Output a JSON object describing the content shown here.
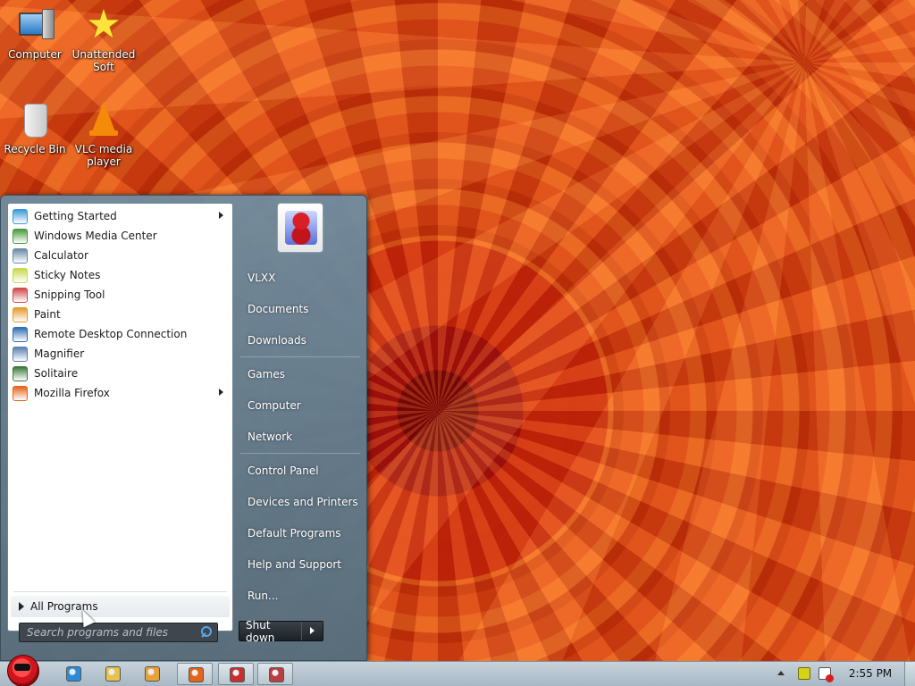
{
  "desktop": {
    "icons": [
      {
        "label": "Computer",
        "icon": "computer-icon"
      },
      {
        "label": "Unattended\nSoft",
        "icon": "star-icon"
      },
      {
        "label": "Recycle Bin",
        "icon": "recycle-bin-icon"
      },
      {
        "label": "VLC media\nplayer",
        "icon": "vlc-cone-icon"
      }
    ]
  },
  "start_menu": {
    "pinned": [
      {
        "label": "Getting Started",
        "icon": "getting-started-icon",
        "color": "#3b9ad9",
        "submenu": true
      },
      {
        "label": "Windows Media Center",
        "icon": "media-center-icon",
        "color": "#4a9a3c",
        "submenu": false
      },
      {
        "label": "Calculator",
        "icon": "calculator-icon",
        "color": "#6a8aa8",
        "submenu": false
      },
      {
        "label": "Sticky Notes",
        "icon": "sticky-notes-icon",
        "color": "#c9d84a",
        "submenu": false
      },
      {
        "label": "Snipping Tool",
        "icon": "snipping-tool-icon",
        "color": "#d24a4a",
        "submenu": false
      },
      {
        "label": "Paint",
        "icon": "paint-icon",
        "color": "#e59a2b",
        "submenu": false
      },
      {
        "label": "Remote Desktop Connection",
        "icon": "remote-desktop-icon",
        "color": "#2f6db5",
        "submenu": false
      },
      {
        "label": "Magnifier",
        "icon": "magnifier-icon",
        "color": "#5a7fb0",
        "submenu": false
      },
      {
        "label": "Solitaire",
        "icon": "solitaire-icon",
        "color": "#3a7a3a",
        "submenu": false
      },
      {
        "label": "Mozilla Firefox",
        "icon": "firefox-icon",
        "color": "#e5641a",
        "submenu": true
      }
    ],
    "all_programs": "All Programs",
    "search_placeholder": "Search programs and files",
    "right_links": {
      "user": "VLXX",
      "documents": "Documents",
      "downloads": "Downloads",
      "games": "Games",
      "computer": "Computer",
      "network": "Network",
      "control_panel": "Control Panel",
      "devices": "Devices and Printers",
      "default_programs": "Default Programs",
      "help": "Help and Support",
      "run": "Run..."
    },
    "shutdown_label": "Shut down"
  },
  "taskbar": {
    "pinned_apps": [
      {
        "icon": "internet-explorer-icon",
        "color": "#2c8ad8",
        "active": false
      },
      {
        "icon": "folder-icon",
        "color": "#e8c24a",
        "active": false
      },
      {
        "icon": "media-player-icon",
        "color": "#e8a23a",
        "active": false
      },
      {
        "icon": "firefox-icon",
        "color": "#e5641a",
        "active": true
      },
      {
        "icon": "app-red-icon",
        "color": "#c83030",
        "active": true
      },
      {
        "icon": "app-bird-icon",
        "color": "#b84040",
        "active": true
      }
    ],
    "clock": "2:55 PM"
  }
}
